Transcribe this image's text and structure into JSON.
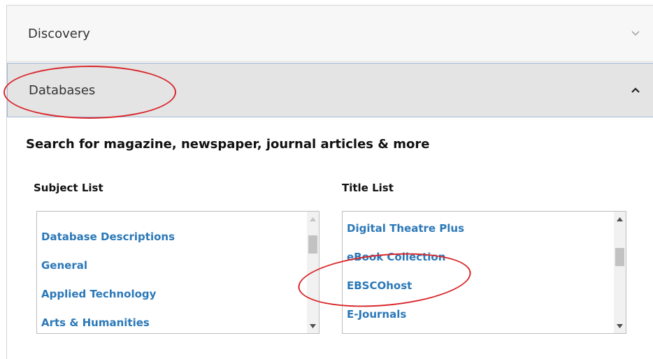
{
  "accordion": {
    "discovery_label": "Discovery",
    "databases_label": "Databases"
  },
  "section": {
    "heading": "Search for magazine, newspaper, journal articles & more"
  },
  "subject_list": {
    "title": "Subject List",
    "items": [
      "Database Descriptions",
      "General",
      "Applied Technology",
      "Arts & Humanities"
    ]
  },
  "title_list": {
    "title": "Title List",
    "items": [
      "Digital Theatre Plus",
      "eBook Collection",
      "EBSCOhost",
      "E-Journals"
    ]
  },
  "icons": {
    "discovery_toggle": "chevron-down-icon",
    "databases_toggle": "chevron-up-icon",
    "scroll_up": "triangle-up-icon",
    "scroll_down": "triangle-down-icon"
  },
  "colors": {
    "link": "#2b78b8",
    "annotation": "#d9262b",
    "active_header": "#e4e4e4",
    "active_border": "#9fb9d6"
  }
}
